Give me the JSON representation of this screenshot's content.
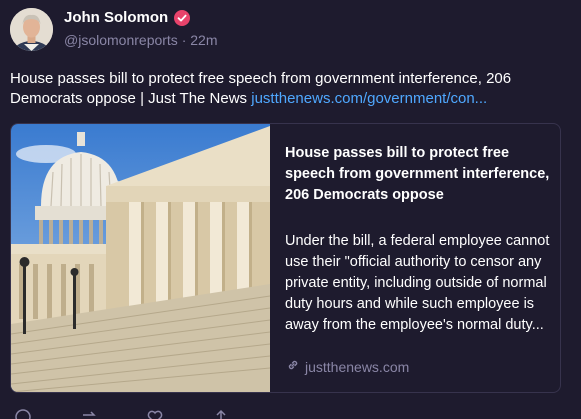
{
  "author": {
    "name": "John Solomon",
    "handle_line": "@jsolomonreports · 22m",
    "avatar_icon": "person-photo-avatar",
    "verified_icon": "verified-badge-icon"
  },
  "post": {
    "text": "House passes bill to protect free speech from government interference, 206 Democrats oppose  | Just The News ",
    "link": "justthenews.com/government/con..."
  },
  "card": {
    "title": "House passes bill to protect free speech from government interference, 206 Democrats oppose",
    "description": "Under the bill, a federal employee cannot use their \"official authority to censor any private entity, including outside of normal duty hours and while such employee is away from the employee's normal duty...",
    "domain": "justthenews.com",
    "image_icon": "us-capitol-building-photo"
  },
  "actions": [
    "reply-icon",
    "repost-icon",
    "like-icon",
    "more-icon"
  ],
  "colors": {
    "background": "#1e1b2e",
    "link": "#4fa8ff",
    "muted": "#8a86a6",
    "border": "#37334d",
    "verified": "#e8436b"
  }
}
